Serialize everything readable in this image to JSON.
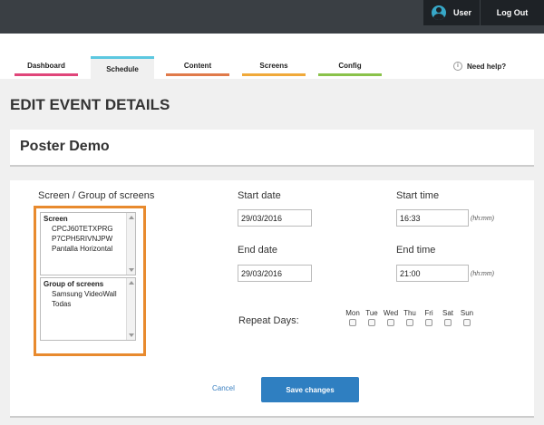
{
  "header": {
    "user_label": "User",
    "logout_label": "Log Out"
  },
  "nav": {
    "tabs": [
      {
        "label": "Dashboard",
        "color": "#e0457a"
      },
      {
        "label": "Schedule",
        "color": "#5cc8e0",
        "active": true
      },
      {
        "label": "Content",
        "color": "#e07a4a"
      },
      {
        "label": "Screens",
        "color": "#f0a93a"
      },
      {
        "label": "Config",
        "color": "#8ac24a"
      }
    ],
    "help_label": "Need help?",
    "help_icon_glyph": "i"
  },
  "page": {
    "title": "EDIT EVENT DETAILS",
    "event_name": "Poster Demo"
  },
  "form": {
    "screens_label": "Screen / Group of screens",
    "screen_header": "Screen",
    "screens": [
      "CPCJ60TETXPRG",
      "P7CPH5RIVNJPW",
      "Pantalla Horizontal"
    ],
    "group_header": "Group of screens",
    "groups": [
      "Samsung VideoWall",
      "Todas"
    ],
    "start_date_label": "Start date",
    "start_date": "29/03/2016",
    "start_time_label": "Start time",
    "start_time": "16:33",
    "end_date_label": "End date",
    "end_date": "29/03/2016",
    "end_time_label": "End time",
    "end_time": "21:00",
    "time_hint": "(hh:mm)",
    "repeat_label": "Repeat Days:",
    "days": [
      "Mon",
      "Tue",
      "Wed",
      "Thu",
      "Fri",
      "Sat",
      "Sun"
    ],
    "cancel_label": "Cancel",
    "save_label": "Save changes"
  },
  "colors": {
    "accent": "#2f7fc1",
    "highlight": "#e88a2e",
    "topbar": "#3a3f44"
  }
}
